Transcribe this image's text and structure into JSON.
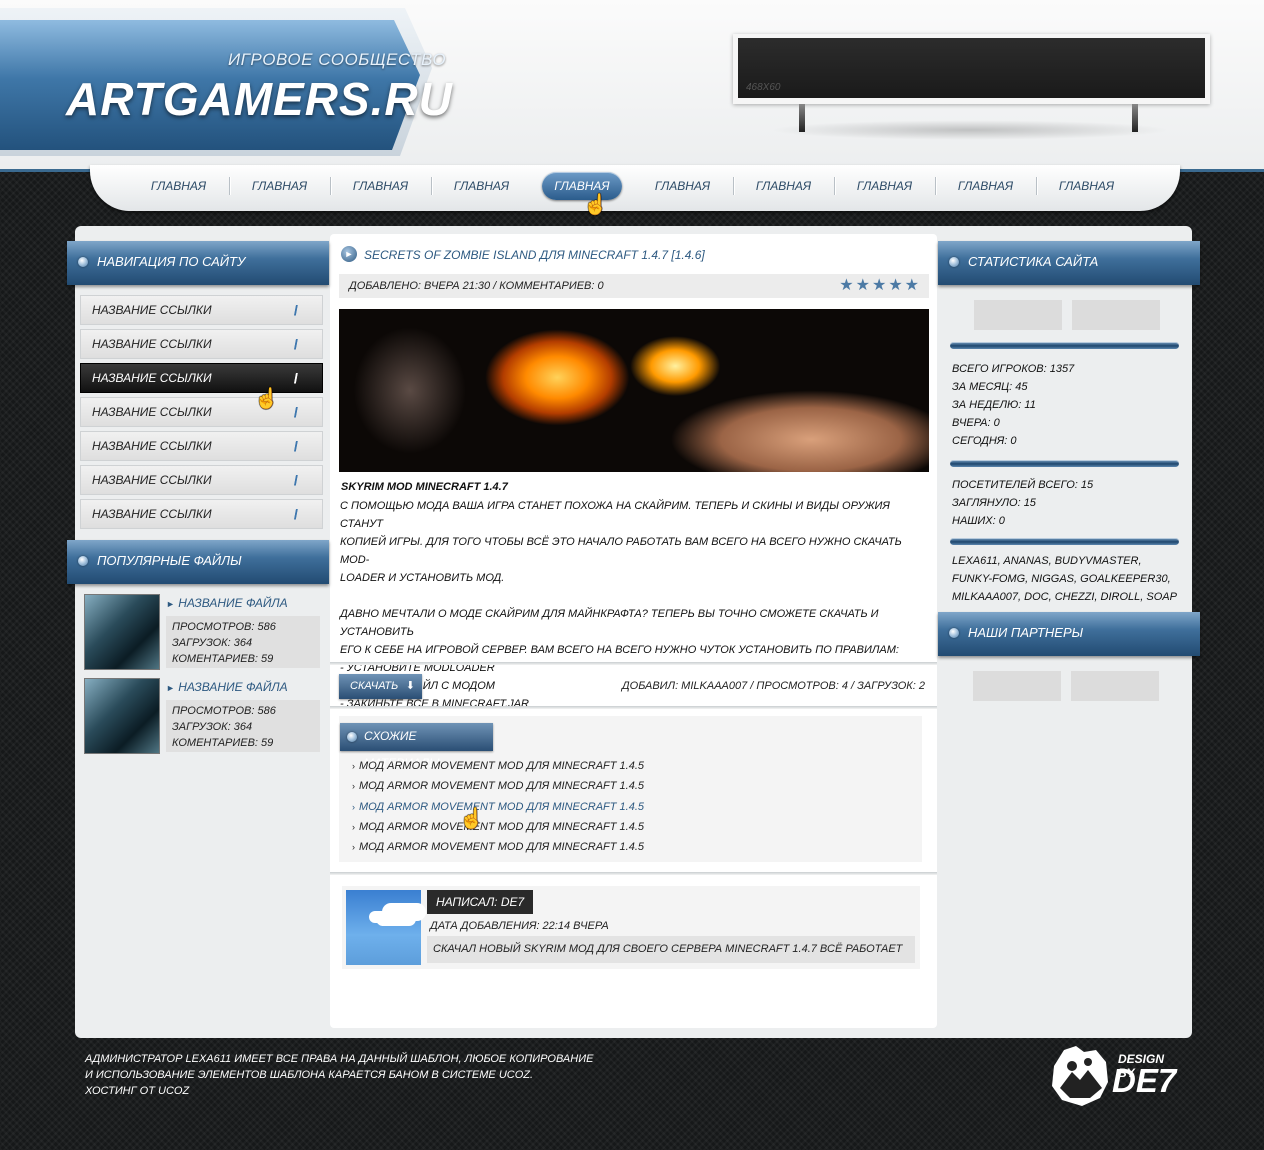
{
  "header": {
    "logo_subtitle": "ИГРОВОЕ СООБЩЕСТВО",
    "logo_title": "ARTGAMERS.RU",
    "banner_label": "468X60"
  },
  "nav": {
    "items": [
      "ГЛАВНАЯ",
      "ГЛАВНАЯ",
      "ГЛАВНАЯ",
      "ГЛАВНАЯ",
      "ГЛАВНАЯ",
      "ГЛАВНАЯ",
      "ГЛАВНАЯ",
      "ГЛАВНАЯ",
      "ГЛАВНАЯ",
      "ГЛАВНАЯ"
    ],
    "active_index": 4
  },
  "left": {
    "nav_title": "НАВИГАЦИЯ ПО САЙТУ",
    "links": [
      "НАЗВАНИЕ ССЫЛКИ",
      "НАЗВАНИЕ ССЫЛКИ",
      "НАЗВАНИЕ ССЫЛКИ",
      "НАЗВАНИЕ ССЫЛКИ",
      "НАЗВАНИЕ ССЫЛКИ",
      "НАЗВАНИЕ ССЫЛКИ",
      "НАЗВАНИЕ ССЫЛКИ"
    ],
    "active_link": 2,
    "files_title": "ПОПУЛЯРНЫЕ ФАЙЛЫ",
    "files": [
      {
        "name": "НАЗВАНИЕ ФАЙЛА",
        "views": "ПРОСМОТРОВ: 586",
        "downloads": "ЗАГРУЗОК: 364",
        "comments": "КОМЕНТАРИЕВ: 59"
      },
      {
        "name": "НАЗВАНИЕ ФАЙЛА",
        "views": "ПРОСМОТРОВ: 586",
        "downloads": "ЗАГРУЗОК: 364",
        "comments": "КОМЕНТАРИЕВ: 59"
      }
    ]
  },
  "article": {
    "title": "SECRETS OF ZOMBIE ISLAND ДЛЯ MINECRAFT 1.4.7 [1.4.6]",
    "meta": "ДОБАВЛЕНО: ВЧЕРА 21:30  /  КОММЕНТАРИЕВ: 0",
    "stars": "★★★★★",
    "heading": "SKYRIM MOD MINECRAFT 1.4.7",
    "lines": [
      "С ПОМОЩЬЮ МОДА ВАША ИГРА СТАНЕТ ПОХОЖА НА СКАЙРИМ. ТЕПЕРЬ И СКИНЫ И ВИДЫ ОРУЖИЯ СТАНУТ",
      "КОПИЕЙ ИГРЫ. ДЛЯ ТОГО ЧТОБЫ ВСЁ ЭТО НАЧАЛО РАБОТАТЬ ВАМ ВСЕГО НА ВСЕГО НУЖНО СКАЧАТЬ MOD-",
      "LOADER И УСТАНОВИТЬ МОД.",
      "",
      "ДАВНО МЕЧТАЛИ О МОДЕ СКАЙРИМ ДЛЯ МАЙНКРАФТА? ТЕПЕРЬ ВЫ ТОЧНО СМОЖЕТЕ СКАЧАТЬ И УСТАНОВИТЬ",
      "ЕГО К СЕБЕ НА ИГРОВОЙ СЕРВЕР. ВАМ ВСЕГО НА ВСЕГО НУЖНО ЧУТОК УСТАНОВИТЬ ПО ПРАВИЛАМ:",
      "- УСТАНОВИТЕ MODLOADER",
      "- СКАЧАЙТЕ ФАЙЛ С МОДОМ",
      "- ЗАКИНЬТЕ ВСЕ В MINECRAFT.JAR"
    ],
    "download_label": "СКАЧАТЬ",
    "added_meta": "ДОБАВИЛ: MILKAAA007  /  ПРОСМОТРОВ: 4  /  ЗАГРУЗОК: 2"
  },
  "related": {
    "title": "СХОЖИЕ МАТЕРИАЛЫ",
    "items": [
      "МОД ARMOR MOVEMENT MOD ДЛЯ MINECRAFT 1.4.5",
      "МОД ARMOR MOVEMENT MOD ДЛЯ MINECRAFT 1.4.5",
      "МОД ARMOR MOVEMENT MOD ДЛЯ MINECRAFT 1.4.5",
      "МОД ARMOR MOVEMENT MOD ДЛЯ MINECRAFT 1.4.5",
      "МОД ARMOR MOVEMENT MOD ДЛЯ MINECRAFT 1.4.5"
    ],
    "hover_index": 2
  },
  "comment": {
    "author": "НАПИСАЛ: DE7",
    "date": "ДАТА ДОБАВЛЕНИЯ: 22:14 ВЧЕРА",
    "text": "СКАЧАЛ НОВЫЙ SKYRIM МОД ДЛЯ СВОЕГО СЕРВЕРА MINECRAFT 1.4.7 ВСЁ РАБОТАЕТ"
  },
  "right": {
    "stats_title": "СТАТИСТИКА САЙТА",
    "players": [
      "ВСЕГО ИГРОКОВ: 1357",
      "ЗА МЕСЯЦ: 45",
      "ЗА НЕДЕЛЮ: 11",
      "ВЧЕРА: 0",
      "СЕГОДНЯ: 0"
    ],
    "visitors": [
      "ПОСЕТИТЕЛЕЙ ВСЕГО: 15",
      "ЗАГЛЯНУЛО: 15",
      "НАШИХ: 0"
    ],
    "users": "LEXA611, ANANAS, BUDYVMASTER, FUNKY-FOMG, NIGGAS, GOALKEEPER30, MILKAAA007, DOC, CHEZZI, DIROLL, SOAP",
    "partners_title": "НАШИ ПАРТНЕРЫ"
  },
  "footer": {
    "lines": [
      "АДМИНИСТРАТОР LEXA611 ИМЕЕТ ВСЕ ПРАВА НА ДАННЫЙ ШАБЛОН, ЛЮБОЕ КОПИРОВАНИЕ",
      "И ИСПОЛЬЗОВАНИЕ ЭЛЕМЕНТОВ ШАБЛОНА КАРАЕТСЯ БАНОМ В СИСТЕМЕ UCOZ.",
      "ХОСТИНГ ОТ UCOZ"
    ],
    "design_by": "DESIGN BY",
    "designer": "DE7"
  }
}
